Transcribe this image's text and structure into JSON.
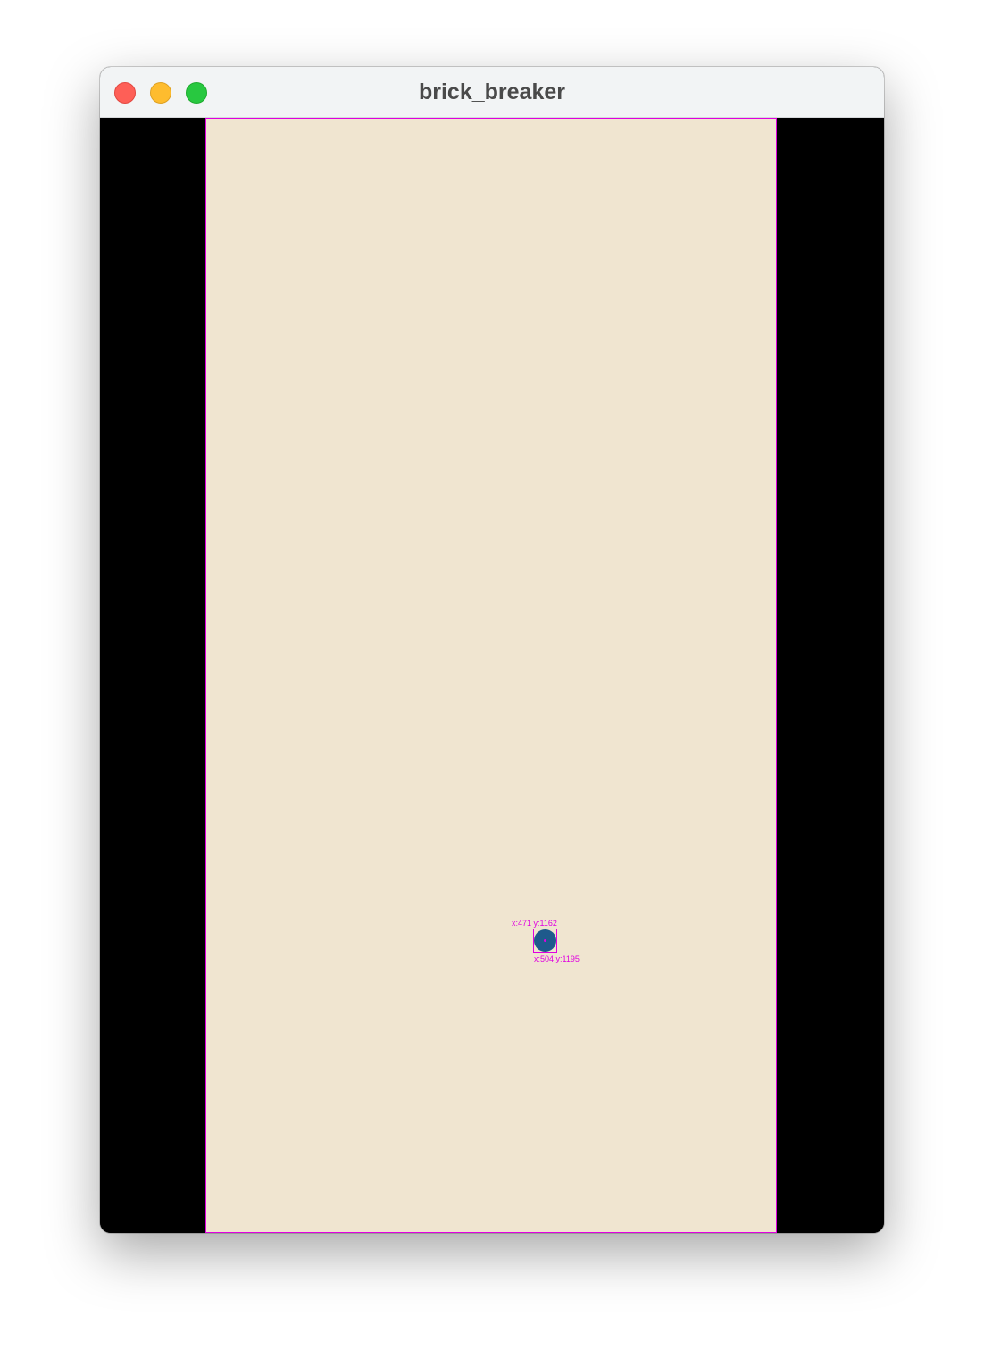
{
  "window": {
    "title": "brick_breaker"
  },
  "colors": {
    "playfield_background": "#f0e5d0",
    "letterbox": "#000000",
    "debug_outline": "#e000e0",
    "ball": "#1e5a8c",
    "ball_center": "#e000e0"
  },
  "ball": {
    "debug_top_left": "x:471 y:1162",
    "debug_bottom_right": "x:504 y:1195"
  }
}
